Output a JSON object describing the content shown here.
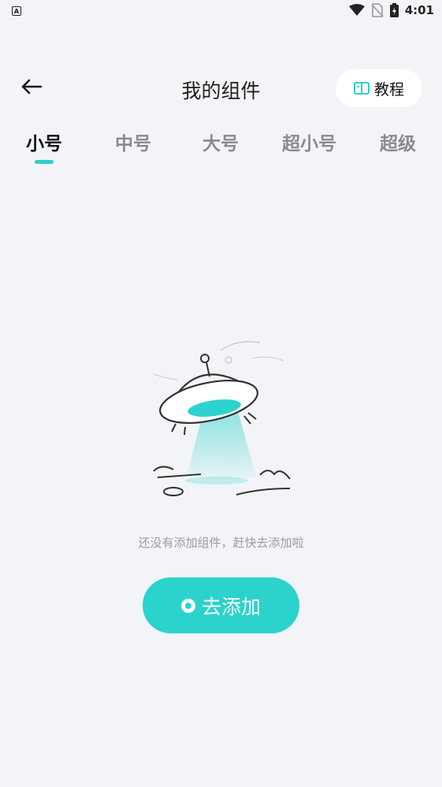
{
  "status_bar": {
    "time": "4:01",
    "left_badge": "A"
  },
  "header": {
    "title": "我的组件",
    "tutorial_label": "教程"
  },
  "tabs": [
    {
      "label": "小号",
      "active": true
    },
    {
      "label": "中号",
      "active": false
    },
    {
      "label": "大号",
      "active": false
    },
    {
      "label": "超小号",
      "active": false
    },
    {
      "label": "超级",
      "active": false
    }
  ],
  "empty_state": {
    "message": "还没有添加组件，赶快去添加啦"
  },
  "add_button": {
    "label": "去添加"
  },
  "colors": {
    "accent": "#2cd3cc",
    "background": "#f3f4f8"
  }
}
